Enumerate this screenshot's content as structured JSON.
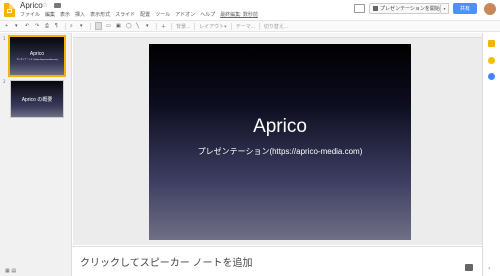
{
  "app": {
    "title": "Aprico",
    "menu": [
      "ファイル",
      "編集",
      "表示",
      "挿入",
      "表示形式",
      "スライド",
      "配置",
      "ツール",
      "アドオン",
      "ヘルプ",
      "最終編集: 数秒前"
    ],
    "present_label": "プレゼンテーションを開始",
    "share_label": "共有"
  },
  "toolbar": {
    "background_label": "背景...",
    "layout_label": "レイアウト▾",
    "theme_label": "テーマ...",
    "transition_label": "切り替え..."
  },
  "filmstrip": {
    "slides": [
      {
        "num": "1",
        "title": "Aprico",
        "subtitle": "プレゼンテーション(https://aprico-media.com)"
      },
      {
        "num": "2",
        "title": "Aprico の概要",
        "subtitle": ""
      }
    ]
  },
  "slide": {
    "title": "Aprico",
    "subtitle": "プレゼンテーション(https://aprico-media.com)"
  },
  "notes": {
    "placeholder": "クリックしてスピーカー ノートを追加"
  },
  "colors": {
    "accent": "#f4b400",
    "share": "#4d90fe"
  }
}
